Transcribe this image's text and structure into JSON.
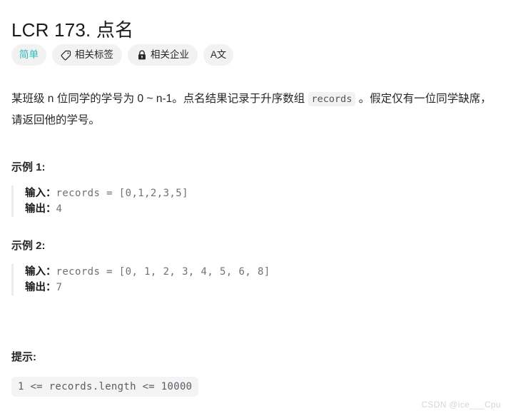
{
  "problem": {
    "title": "LCR 173. 点名",
    "description_part_1": "某班级 n 位同学的学号为 0 ~ n-1。点名结果记录于升序数组 ",
    "description_code": "records",
    "description_part_2": " 。假定仅有一位同学缺席，请返回他的学号。"
  },
  "badges": {
    "difficulty": "简单",
    "tags": "相关标签",
    "companies": "相关企业",
    "translate": "A文"
  },
  "examples": [
    {
      "heading": "示例 1:",
      "input_label": "输入：",
      "input_value": "records = [0,1,2,3,5]",
      "output_label": "输出：",
      "output_value": "4"
    },
    {
      "heading": "示例 2:",
      "input_label": "输入：",
      "input_value": "records = [0, 1, 2, 3, 4, 5, 6, 8]",
      "output_label": "输出：",
      "output_value": "7"
    }
  ],
  "hints": {
    "heading": "提示:",
    "items": [
      "1 <= records.length <= 10000"
    ]
  },
  "watermark": "CSDN @ice___Cpu",
  "colors": {
    "difficulty_teal": "#2db8b8",
    "badge_background": "#f2f2f2",
    "code_background": "#f4f4f4",
    "text_primary": "#262626",
    "code_text": "#70707a",
    "blockquote_border": "#ebebeb",
    "watermark": "#d6d6d6"
  }
}
